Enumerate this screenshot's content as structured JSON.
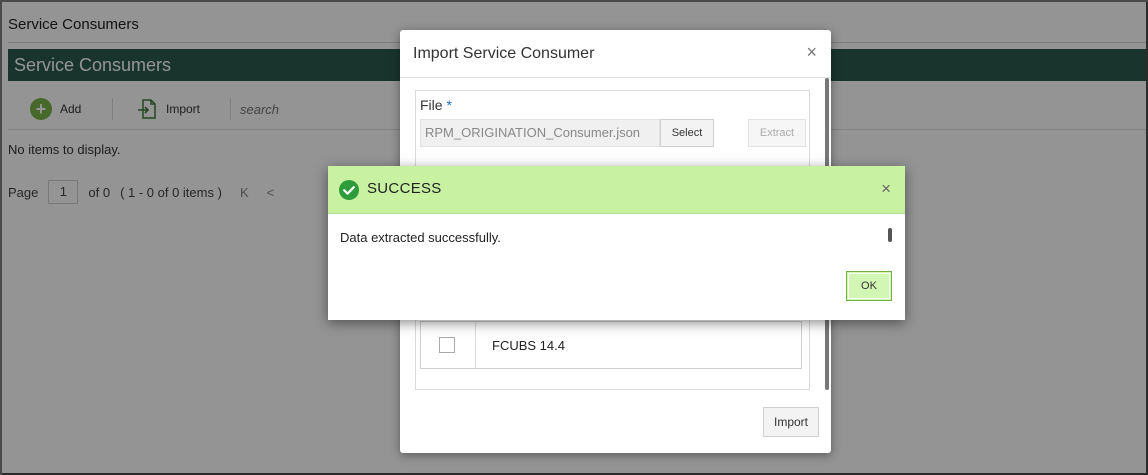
{
  "page": {
    "title": "Service Consumers",
    "header": "Service Consumers",
    "toolbar": {
      "add_label": "Add",
      "import_label": "Import",
      "search_placeholder": "search"
    },
    "empty_text": "No items to display.",
    "pager": {
      "page_label": "Page",
      "page_value": "1",
      "of_label": "of 0",
      "summary": "( 1 - 0 of 0 items )",
      "first": "K",
      "prev": "<"
    }
  },
  "import_dialog": {
    "title": "Import Service Consumer",
    "close": "×",
    "file_label": "File",
    "required": "*",
    "file_value": "RPM_ORIGINATION_Consumer.json",
    "select_label": "Select",
    "extract_label": "Extract",
    "grid_row": "FCUBS 14.4",
    "import_label": "Import"
  },
  "success_dialog": {
    "title": "SUCCESS",
    "close": "×",
    "message": "Data extracted successfully.",
    "ok_label": "OK"
  },
  "colors": {
    "header_bar": "#2c5a4e",
    "success_header": "#c8f2a2",
    "success_icon": "#2f9c3c",
    "add_icon": "#7ab34a"
  }
}
